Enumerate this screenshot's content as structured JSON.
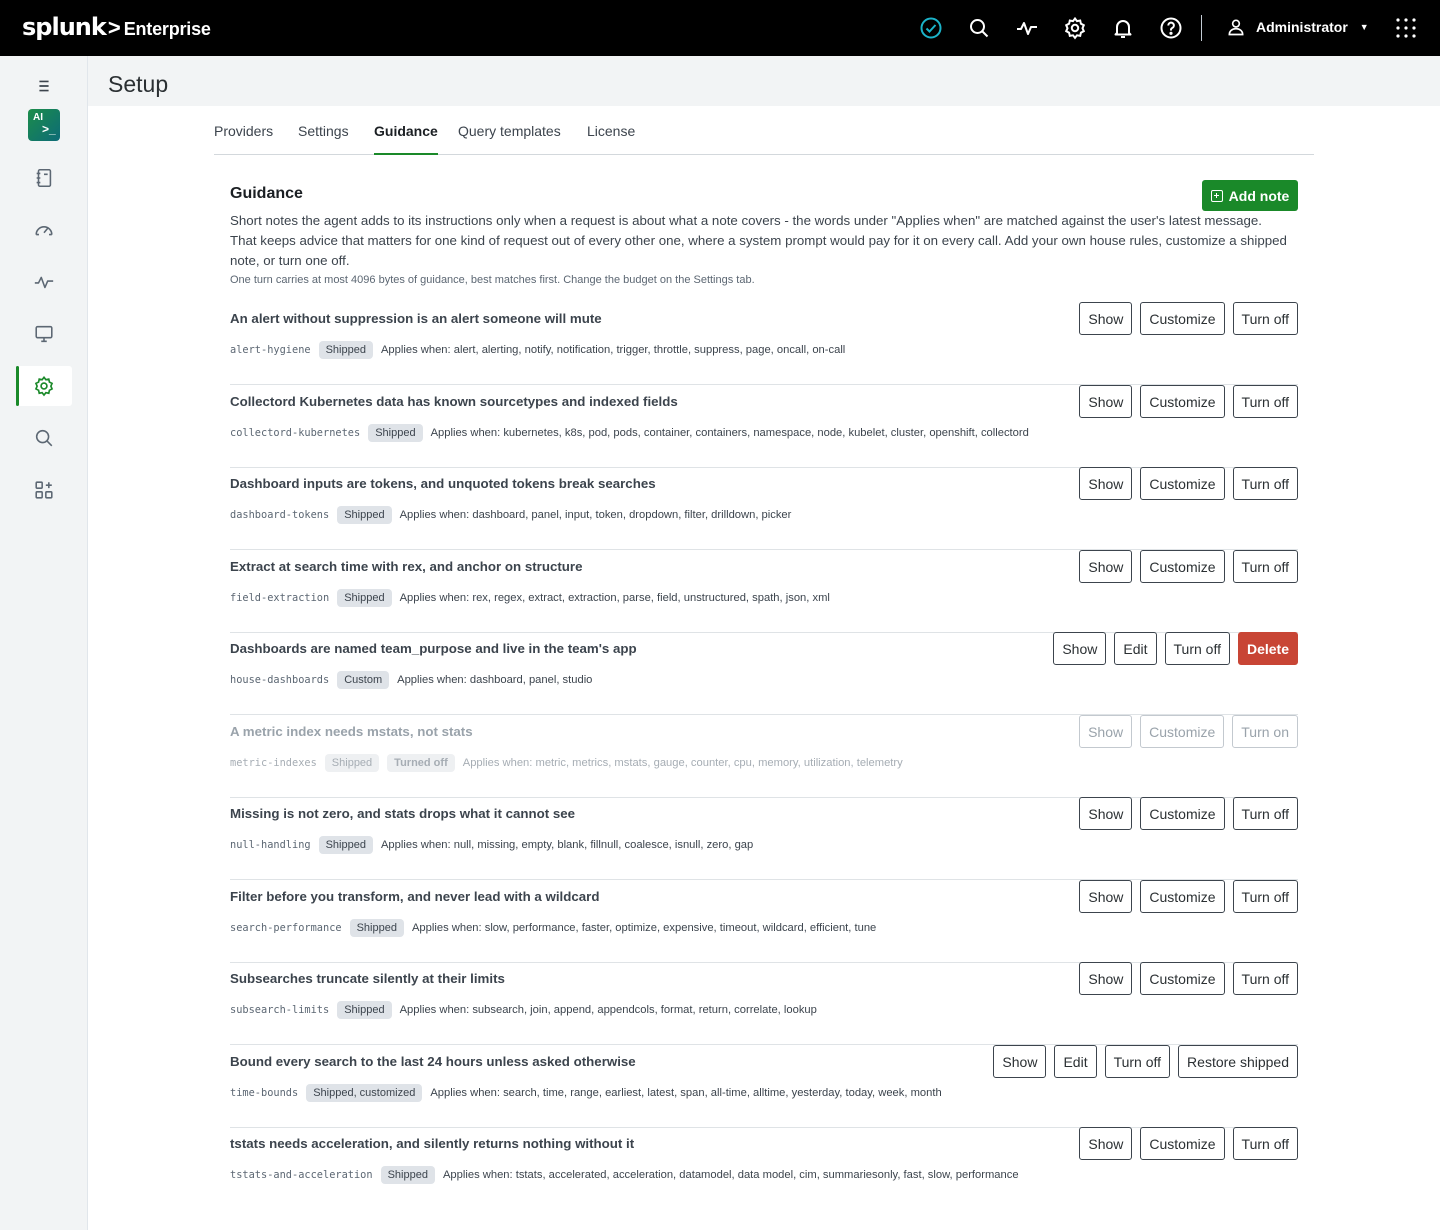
{
  "app": {
    "brand": "splunk",
    "separator": ">",
    "product": "Enterprise",
    "user": "Administrator"
  },
  "icons": {
    "status": "check-circle-icon",
    "search": "search-icon",
    "activity": "activity-icon",
    "settings": "gear-icon",
    "notifications": "bell-icon",
    "help": "help-icon",
    "apps": "grid-icon"
  },
  "colors": {
    "accent": "#1a8929",
    "danger": "#c84535",
    "status_ok": "#1bb3c9"
  },
  "sidebar": {
    "ai_badge_line1": "AI",
    "ai_badge_line2": ">_",
    "items": [
      "menu",
      "ai-assistant",
      "notebook",
      "dashboards",
      "activity",
      "display",
      "setup",
      "search",
      "apps"
    ]
  },
  "page": {
    "title": "Setup"
  },
  "tabs": [
    {
      "label": "Providers"
    },
    {
      "label": "Settings"
    },
    {
      "label": "Guidance",
      "active": true
    },
    {
      "label": "Query templates"
    },
    {
      "label": "License"
    }
  ],
  "guidance": {
    "title": "Guidance",
    "add_label": "Add note",
    "intro": "Short notes the agent adds to its instructions only when a request is about what a note covers - the words under \"Applies when\" are matched against the user's latest message. That keeps advice that matters for one kind of request out of every other one, where a system prompt would pay for it on every call. Add your own house rules, customize a shipped note, or turn one off.",
    "budget": "One turn carries at most 4096 bytes of guidance, best matches first. Change the budget on the Settings tab.",
    "notes": [
      {
        "title": "An alert without suppression is an alert someone will mute",
        "slug": "alert-hygiene",
        "badge": "Shipped",
        "applies": "Applies when: alert, alerting, notify, notification, trigger, throttle, suppress, page, oncall, on-call",
        "b1": "Show",
        "b2": "Customize",
        "b3": "Turn off"
      },
      {
        "title": "Collectord Kubernetes data has known sourcetypes and indexed fields",
        "slug": "collectord-kubernetes",
        "badge": "Shipped",
        "applies": "Applies when: kubernetes, k8s, pod, pods, container, containers, namespace, node, kubelet, cluster, openshift, collectord",
        "b1": "Show",
        "b2": "Customize",
        "b3": "Turn off"
      },
      {
        "title": "Dashboard inputs are tokens, and unquoted tokens break searches",
        "slug": "dashboard-tokens",
        "badge": "Shipped",
        "applies": "Applies when: dashboard, panel, input, token, dropdown, filter, drilldown, picker",
        "b1": "Show",
        "b2": "Customize",
        "b3": "Turn off"
      },
      {
        "title": "Extract at search time with rex, and anchor on structure",
        "slug": "field-extraction",
        "badge": "Shipped",
        "applies": "Applies when: rex, regex, extract, extraction, parse, field, unstructured, spath, json, xml",
        "b1": "Show",
        "b2": "Customize",
        "b3": "Turn off"
      },
      {
        "title": "Dashboards are named team_purpose and live in the team's app",
        "slug": "house-dashboards",
        "badge": "Custom",
        "applies": "Applies when: dashboard, panel, studio",
        "b1": "Show",
        "b2": "Edit",
        "b3": "Turn off",
        "b4": "Delete"
      },
      {
        "title": "A metric index needs mstats, not stats",
        "slug": "metric-indexes",
        "badge": "Shipped",
        "badge2": "Turned off",
        "applies": "Applies when: metric, metrics, mstats, gauge, counter, cpu, memory, utilization, telemetry",
        "b1": "Show",
        "b2": "Customize",
        "b3": "Turn on"
      },
      {
        "title": "Missing is not zero, and stats drops what it cannot see",
        "slug": "null-handling",
        "badge": "Shipped",
        "applies": "Applies when: null, missing, empty, blank, fillnull, coalesce, isnull, zero, gap",
        "b1": "Show",
        "b2": "Customize",
        "b3": "Turn off"
      },
      {
        "title": "Filter before you transform, and never lead with a wildcard",
        "slug": "search-performance",
        "badge": "Shipped",
        "applies": "Applies when: slow, performance, faster, optimize, expensive, timeout, wildcard, efficient, tune",
        "b1": "Show",
        "b2": "Customize",
        "b3": "Turn off"
      },
      {
        "title": "Subsearches truncate silently at their limits",
        "slug": "subsearch-limits",
        "badge": "Shipped",
        "applies": "Applies when: subsearch, join, append, appendcols, format, return, correlate, lookup",
        "b1": "Show",
        "b2": "Customize",
        "b3": "Turn off"
      },
      {
        "title": "Bound every search to the last 24 hours unless asked otherwise",
        "slug": "time-bounds",
        "badge": "Shipped, customized",
        "applies": "Applies when: search, time, range, earliest, latest, span, all-time, alltime, yesterday, today, week, month",
        "b1": "Show",
        "b2": "Edit",
        "b3": "Turn off",
        "b4": "Restore shipped"
      },
      {
        "title": "tstats needs acceleration, and silently returns nothing without it",
        "slug": "tstats-and-acceleration",
        "badge": "Shipped",
        "applies": "Applies when: tstats, accelerated, acceleration, datamodel, data model, cim, summariesonly, fast, slow, performance",
        "b1": "Show",
        "b2": "Customize",
        "b3": "Turn off"
      }
    ]
  }
}
